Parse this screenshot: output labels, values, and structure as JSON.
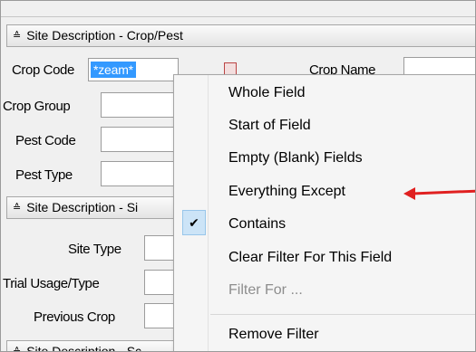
{
  "sections": {
    "crop_pest": {
      "title": "Site Description - Crop/Pest",
      "collapse_glyph": "≙"
    },
    "site": {
      "title": "Site Description - Si",
      "collapse_glyph": "≙"
    },
    "bottom": {
      "title": "Site Description - Sc",
      "collapse_glyph": "≙"
    }
  },
  "fields": {
    "crop_code": {
      "label": "Crop Code",
      "value": "*zeam*"
    },
    "crop_name": {
      "label": "Crop Name"
    },
    "crop_group": {
      "label": "Crop Group"
    },
    "pest_code": {
      "label": "Pest Code"
    },
    "pest_type": {
      "label": "Pest Type"
    },
    "site_type": {
      "label": "Site Type"
    },
    "trial_usage": {
      "label": "Trial Usage/Type"
    },
    "previous_crop": {
      "label": "Previous Crop"
    }
  },
  "context_menu": {
    "items": [
      {
        "label": "Whole Field",
        "checked": false,
        "enabled": true
      },
      {
        "label": "Start of Field",
        "checked": false,
        "enabled": true
      },
      {
        "label": "Empty (Blank) Fields",
        "checked": false,
        "enabled": true
      },
      {
        "label": "Everything Except",
        "checked": false,
        "enabled": true
      },
      {
        "label": "Contains",
        "checked": true,
        "enabled": true
      },
      {
        "label": "Clear Filter For This Field",
        "checked": false,
        "enabled": true
      },
      {
        "label": "Filter For ...",
        "checked": false,
        "enabled": false
      },
      {
        "label": "Remove Filter",
        "checked": false,
        "enabled": true
      }
    ],
    "check_glyph": "✔"
  },
  "colors": {
    "selection_highlight": "#3399ff",
    "menu_background": "#f5f5f5",
    "check_highlight": "#cce4f7",
    "annotation_arrow": "#e02020",
    "disabled_text": "#8d8d8d"
  }
}
